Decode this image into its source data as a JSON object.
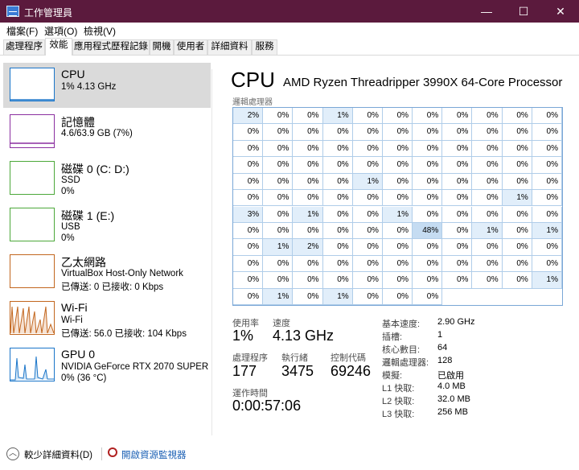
{
  "window": {
    "title": "工作管理員",
    "minimize": "—",
    "maximize": "☐",
    "close": "✕"
  },
  "menu": [
    "檔案(F)",
    "選項(O)",
    "檢視(V)"
  ],
  "tabs": [
    "處理程序",
    "效能",
    "應用程式歷程記錄",
    "開機",
    "使用者",
    "詳細資料",
    "服務"
  ],
  "sidebar": [
    {
      "title": "CPU",
      "sub1": "1% 4.13 GHz",
      "sub2": "",
      "color": "#1a75c9"
    },
    {
      "title": "記憶體",
      "sub1": "4.6/63.9 GB (7%)",
      "sub2": "",
      "color": "#8b2fa0"
    },
    {
      "title": "磁碟 0 (C: D:)",
      "sub1": "SSD",
      "sub2": "0%",
      "color": "#4ca83a"
    },
    {
      "title": "磁碟 1 (E:)",
      "sub1": "USB",
      "sub2": "0%",
      "color": "#4ca83a"
    },
    {
      "title": "乙太網路",
      "sub1": "VirtualBox Host-Only Network",
      "sub2": "已傳送: 0 已接收: 0 Kbps",
      "color": "#c2661e"
    },
    {
      "title": "Wi-Fi",
      "sub1": "Wi-Fi",
      "sub2": "已傳送: 56.0 已接收: 104 Kbps",
      "color": "#c2661e"
    },
    {
      "title": "GPU 0",
      "sub1": "NVIDIA GeForce RTX 2070 SUPER",
      "sub2": "0% (36 °C)",
      "color": "#1a75c9"
    }
  ],
  "main": {
    "title": "CPU",
    "cpu_name": "AMD Ryzen Threadripper 3990X 64-Core Processor",
    "grid_label": "邏輯處理器",
    "cores": [
      "2%",
      "0%",
      "0%",
      "1%",
      "0%",
      "0%",
      "0%",
      "0%",
      "0%",
      "0%",
      "0%",
      "0%",
      "0%",
      "0%",
      "0%",
      "0%",
      "0%",
      "0%",
      "0%",
      "0%",
      "0%",
      "0%",
      "0%",
      "0%",
      "0%",
      "0%",
      "0%",
      "0%",
      "0%",
      "0%",
      "0%",
      "0%",
      "0%",
      "0%",
      "0%",
      "0%",
      "0%",
      "0%",
      "0%",
      "0%",
      "0%",
      "0%",
      "0%",
      "0%",
      "0%",
      "0%",
      "0%",
      "0%",
      "1%",
      "0%",
      "0%",
      "0%",
      "0%",
      "0%",
      "0%",
      "0%",
      "0%",
      "0%",
      "0%",
      "0%",
      "0%",
      "0%",
      "0%",
      "0%",
      "1%",
      "0%",
      "3%",
      "0%",
      "1%",
      "0%",
      "0%",
      "1%",
      "0%",
      "0%",
      "0%",
      "0%",
      "0%",
      "0%",
      "0%",
      "0%",
      "0%",
      "0%",
      "0%",
      "48%",
      "0%",
      "1%",
      "0%",
      "1%",
      "0%",
      "1%",
      "2%",
      "0%",
      "0%",
      "0%",
      "0%",
      "0%",
      "0%",
      "0%",
      "0%",
      "0%",
      "0%",
      "0%",
      "0%",
      "0%",
      "0%",
      "0%",
      "0%",
      "0%",
      "0%",
      "0%",
      "0%",
      "0%",
      "0%",
      "0%",
      "0%",
      "0%",
      "0%",
      "0%",
      "0%",
      "0%",
      "1%",
      "0%",
      "1%",
      "0%",
      "1%",
      "0%",
      "0%",
      "0%"
    ],
    "stats": {
      "usage_label": "使用率",
      "usage": "1%",
      "speed_label": "速度",
      "speed": "4.13 GHz",
      "processes_label": "處理程序",
      "processes": "177",
      "threads_label": "執行緒",
      "threads": "3475",
      "handles_label": "控制代碼",
      "handles": "69246",
      "uptime_label": "運作時間",
      "uptime": "0:00:57:06"
    },
    "specs": [
      {
        "label": "基本速度:",
        "value": "2.90 GHz"
      },
      {
        "label": "插槽:",
        "value": "1"
      },
      {
        "label": "核心數目:",
        "value": "64"
      },
      {
        "label": "邏輯處理器:",
        "value": "128"
      },
      {
        "label": "模擬:",
        "value": "已啟用"
      },
      {
        "label": "L1 快取:",
        "value": "4.0 MB"
      },
      {
        "label": "L2 快取:",
        "value": "32.0 MB"
      },
      {
        "label": "L3 快取:",
        "value": "256 MB"
      }
    ]
  },
  "footer": {
    "fewer_details": "較少詳細資料(D)",
    "open_monitor": "開啟資源監視器",
    "link_color": "#1a5fb4"
  }
}
